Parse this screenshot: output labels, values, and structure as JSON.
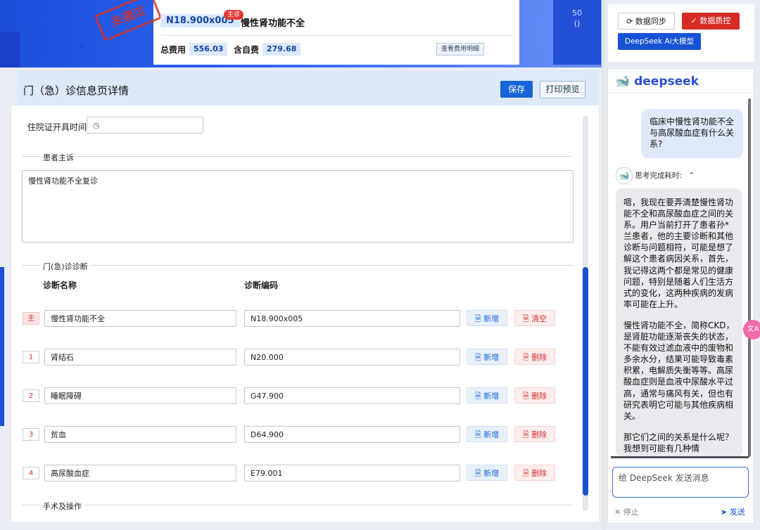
{
  "banner": {
    "stamp": "未通过",
    "diagnosis_code": "N18.900x005",
    "main_tag": "主诊",
    "diagnosis_name": "慢性肾功能不全",
    "total_fee_label": "总费用",
    "total_fee": "556.03",
    "self_fee_label": "含自费",
    "self_fee": "279.68",
    "fee_detail_button": "查看费用明细",
    "right_num": "50",
    "right_paren": "()",
    "left_num": "3"
  },
  "page": {
    "title": "门（急）诊信息页详情",
    "save_button": "保存",
    "print_button": "打印预览"
  },
  "form": {
    "cert_time_label": "住院证开具时间",
    "complaint_section": "患者主诉",
    "complaint_text": "慢性肾功能不全复诊",
    "diagnosis_section": "门(急)诊诊断",
    "col_name": "诊断名称",
    "col_code": "诊断编码",
    "rows": [
      {
        "tag": "主",
        "name": "慢性肾功能不全",
        "code": "N18.900x005",
        "add": "新增",
        "action": "清空"
      },
      {
        "tag": "1",
        "name": "肾结石",
        "code": "N20.000",
        "add": "新增",
        "action": "删除"
      },
      {
        "tag": "2",
        "name": "睡眠障碍",
        "code": "G47.900",
        "add": "新增",
        "action": "删除"
      },
      {
        "tag": "3",
        "name": "贫血",
        "code": "D64.900",
        "add": "新增",
        "action": "删除"
      },
      {
        "tag": "4",
        "name": "高尿酸血症",
        "code": "E79.001",
        "add": "新增",
        "action": "删除"
      }
    ],
    "surgery_section": "手术及操作"
  },
  "toolbar": {
    "sync_button": "数据同步",
    "qc_button": "数据质控",
    "ai_button": "DeepSeek Ai大模型"
  },
  "chat": {
    "brand": "deepseek",
    "user_message": "临床中慢性肾功能不全与高尿酸血症有什么关系?",
    "thinking_label": "思考完成耗时:",
    "answer_p1": "嗯，我现在要弄清楚慢性肾功能不全和高尿酸血症之间的关系。用户当前打开了患者孙*兰患者，他的主要诊断和其他诊断与问题相符，可能是想了解这个患者病因关系，首先，我记得这两个都是常见的健康问题，特别是随着人们生活方式的变化，这两种疾病的发病率可能在上升。",
    "answer_p2": "慢性肾功能不全，简称CKD，是肾脏功能逐渐丧失的状态，不能有效过滤血液中的废物和多余水分，结果可能导致毒素积累，电解质失衡等等。高尿酸血症则是血液中尿酸水平过高，通常与痛风有关，但也有研究表明它可能与其他疾病相关。",
    "answer_p3": "那它们之间的关系是什么呢？我想到可能有几种情",
    "input_placeholder": "给 DeepSeek 发送消息",
    "stop_button": "停止",
    "send_button": "发送",
    "float_label": "文A"
  },
  "colors": {
    "primary": "#1565d8",
    "danger": "#d32f2f",
    "banner_blue": "#1b4fd8"
  }
}
